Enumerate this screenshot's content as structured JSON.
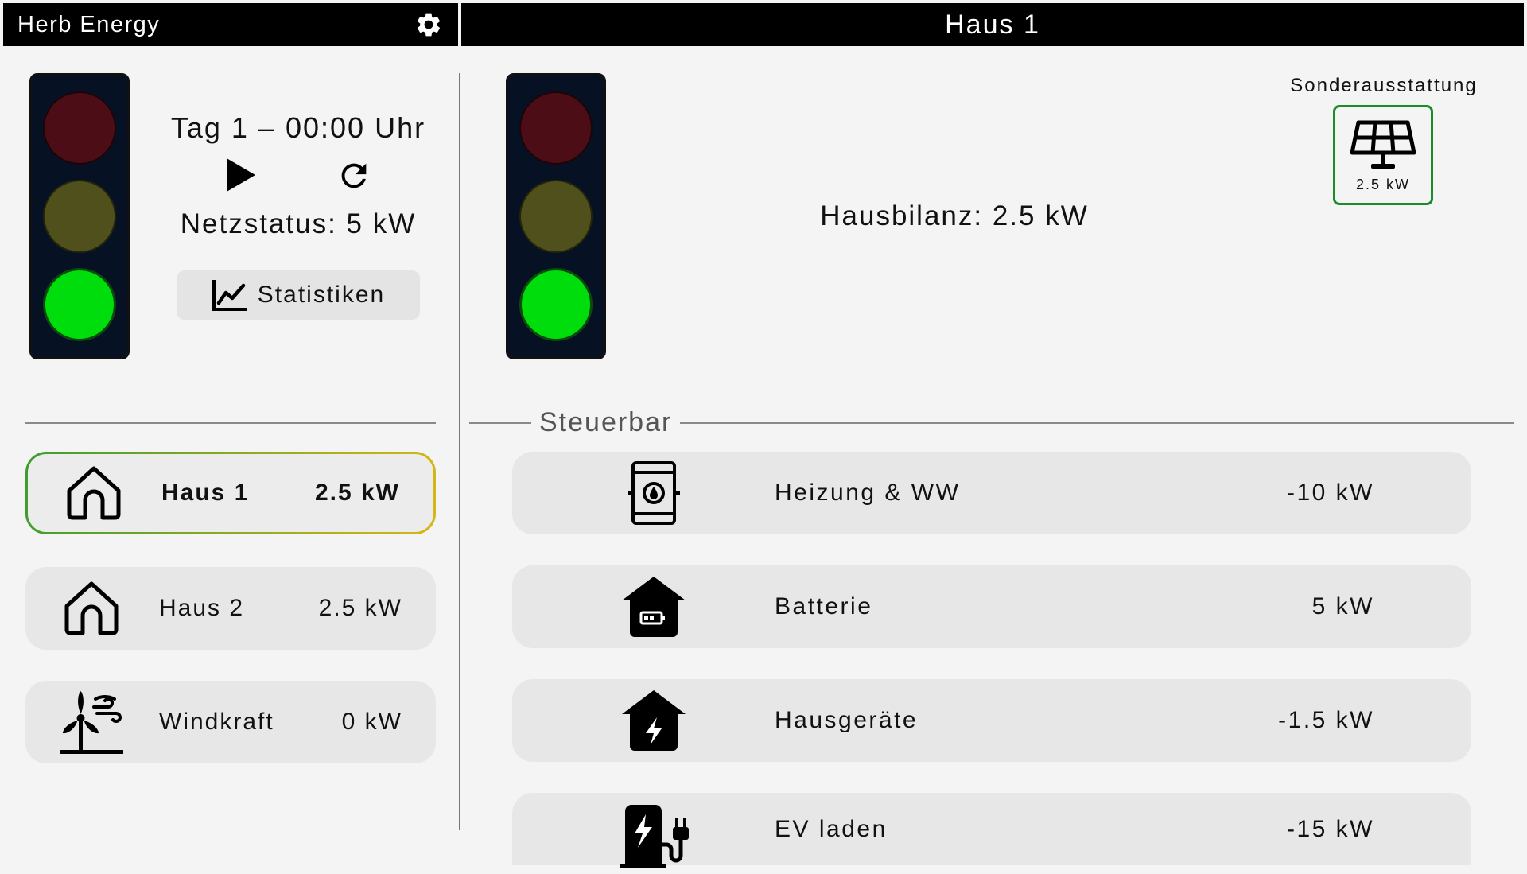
{
  "sidebar_header": {
    "title": "Herb Energy",
    "settings_icon": "gear-icon"
  },
  "main_header": {
    "title": "Haus 1"
  },
  "simulation": {
    "time_text": "Tag 1 – 00:00 Uhr",
    "grid_status": "Netzstatus: 5 kW",
    "statistics_label": "Statistiken",
    "traffic_light_active": "green"
  },
  "sidebar_items": [
    {
      "name": "Haus 1",
      "value": "2.5 kW",
      "icon": "house-icon",
      "selected": true
    },
    {
      "name": "Haus 2",
      "value": "2.5 kW",
      "icon": "house-icon",
      "selected": false
    },
    {
      "name": "Windkraft",
      "value": "0 kW",
      "icon": "wind-turbine-icon",
      "selected": false
    }
  ],
  "house": {
    "balance": "Hausbilanz: 2.5 kW",
    "traffic_light_active": "green",
    "extras_title": "Sonderausstattung",
    "extras": [
      {
        "icon": "solar-panel-icon",
        "value": "2.5 kW"
      }
    ],
    "section_title": "Steuerbar",
    "devices": [
      {
        "name": "Heizung & WW",
        "value": "-10 kW",
        "icon": "water-heater-icon"
      },
      {
        "name": "Batterie",
        "value": "5 kW",
        "icon": "house-battery-icon"
      },
      {
        "name": "Hausgeräte",
        "value": "-1.5 kW",
        "icon": "house-power-icon"
      },
      {
        "name": "EV laden",
        "value": "-15 kW",
        "icon": "ev-charger-icon"
      }
    ]
  },
  "colors": {
    "accent_green": "#00dd0c",
    "selected_border_start": "#3b9e2e",
    "selected_border_end": "#d8b715"
  }
}
